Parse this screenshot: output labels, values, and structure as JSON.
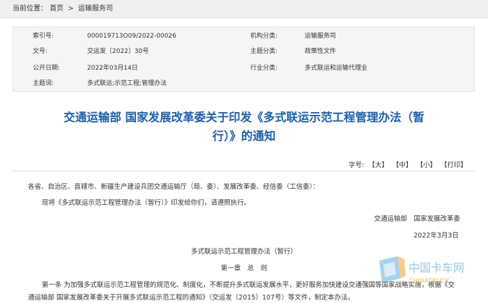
{
  "breadcrumb": {
    "prefix": "当前位置：",
    "home": "首页",
    "separator": ">",
    "section": "运输服务司"
  },
  "meta": {
    "index_label": "索引号:",
    "index_value": "000019713O09/2022-00026",
    "org_label": "机构分类:",
    "org_value": "运输服务司",
    "doc_no_label": "文号:",
    "doc_no_value": "交运发〔2022〕30号",
    "topic_label": "主题分类:",
    "topic_value": "政策性文件",
    "date_label": "公开日期:",
    "date_value": "2022年03月14日",
    "industry_label": "行业分类:",
    "industry_value": "多式联运和运输代理业",
    "keywords_label": "主题词:",
    "keywords_value": "多式联运;示范工程;管理办法"
  },
  "article": {
    "title_line1": "交通运输部 国家发展改革委关于印发《多式联运示范工程管理办法（暂",
    "title_line2": "行）》的通知",
    "tools": {
      "font_label": "字号:",
      "large": "【大】",
      "medium": "【中】",
      "small": "【小】",
      "print": "【打印】"
    },
    "salutation": "各省、自治区、直辖市、新疆生产建设兵团交通运输厅（局、委）、发展改革委、经信委（工信委）：",
    "intro": "现将《多式联运示范工程管理办法（暂行）》印发给你们，请遵照执行。",
    "signers": "交通运输部　国家发展改革委",
    "sign_date": "2022年3月3日",
    "doc_title": "多式联运示范工程管理办法（暂行）",
    "chapter": "第一章　总　则",
    "article1_line1": "第一条 为加强多式联运示范工程管理的规范化、制度化，不断提升多式联运发展水平，更好服务加快建设交通强国等国家战略实施，根据《交",
    "article1_line2": "通运输部 国家发展改革委关于开展多式联运示范工程的通知》（交运发〔2015〕107号）等文件，制定本办法。"
  },
  "watermark": {
    "cn": "中国卡车网",
    "en": "CHINATRUCK"
  }
}
